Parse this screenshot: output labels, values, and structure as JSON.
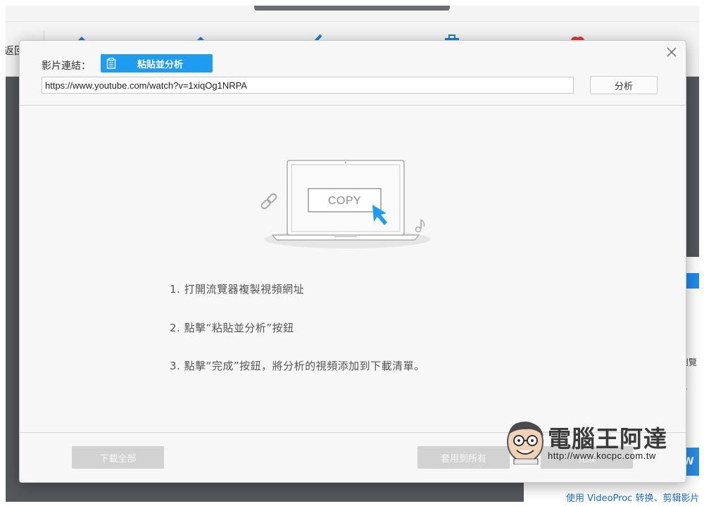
{
  "background_app": {
    "back_label": "返回",
    "right_panel_text_1": "瀏覽",
    "right_panel_text_2": "y",
    "right_panel_button": "W",
    "bottom_link": "使用 VideoProc 转换、剪辑影片"
  },
  "dialog": {
    "url_label": "影片連結：",
    "paste_button": "粘貼並分析",
    "url_value": "https://www.youtube.com/watch?v=1xiqOg1NRPA",
    "analyze_button": "分析",
    "close_icon": "close-icon",
    "illustration": {
      "copy_label": "COPY",
      "icons": [
        "laptop-icon",
        "link-icon",
        "cursor-icon",
        "music-note-icon"
      ]
    },
    "steps": [
      "1. 打開流覽器複製視頻網址",
      "2. 點擊“粘貼並分析”按鈕",
      "3. 點擊“完成”按鈕，將分析的視頻添加到下載清單。"
    ],
    "footer": {
      "download_all": "下載全部",
      "apply_all": "套用到所有",
      "done": "完成"
    }
  },
  "watermark": {
    "title": "電腦王阿達",
    "url": "http://www.kocpc.com.tw"
  },
  "colors": {
    "accent": "#1f9cf0",
    "disabled_button": "#d2d2d2",
    "dialog_bg": "#f7f7f7"
  }
}
